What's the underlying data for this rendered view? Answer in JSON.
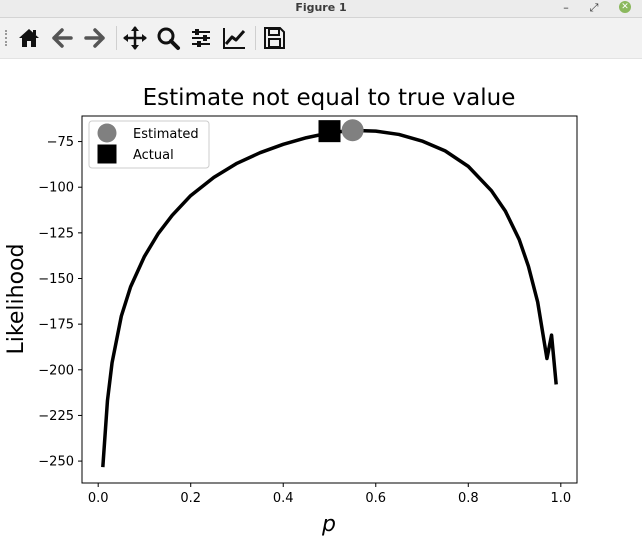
{
  "window": {
    "title": "Figure 1"
  },
  "toolbar": {
    "buttons": [
      "home-icon",
      "back-icon",
      "forward-icon",
      "pan-icon",
      "zoom-icon",
      "configure-subplots-icon",
      "edit-axis-icon",
      "save-icon"
    ]
  },
  "chart_data": {
    "type": "line",
    "title": "Estimate not equal to true value",
    "xlabel": "p",
    "ylabel": "Likelihood",
    "xlim": [
      -0.035,
      1.035
    ],
    "ylim": [
      -262,
      -61
    ],
    "xticks": [
      0.0,
      0.2,
      0.4,
      0.6,
      0.8,
      1.0
    ],
    "xtick_labels": [
      "0.0",
      "0.2",
      "0.4",
      "0.6",
      "0.8",
      "1.0"
    ],
    "yticks": [
      -75,
      -100,
      -125,
      -150,
      -175,
      -200,
      -225,
      -250
    ],
    "ytick_labels": [
      "−75",
      "−100",
      "−125",
      "−150",
      "−175",
      "−200",
      "−225",
      "−250"
    ],
    "grid": false,
    "series": [
      {
        "color": "#000000",
        "x": [
          0.01,
          0.02,
          0.03,
          0.05,
          0.07,
          0.1,
          0.13,
          0.16,
          0.2,
          0.25,
          0.3,
          0.35,
          0.4,
          0.45,
          0.5,
          0.55,
          0.6,
          0.65,
          0.7,
          0.75,
          0.8,
          0.85,
          0.88,
          0.91,
          0.93,
          0.95,
          0.97,
          0.98,
          0.99
        ],
        "y": [
          -253.3,
          -217.0,
          -196.1,
          -170.6,
          -154.6,
          -137.9,
          -125.3,
          -115.4,
          -104.6,
          -94.6,
          -86.9,
          -81.1,
          -76.5,
          -72.9,
          -70.2,
          -68.9,
          -69.3,
          -71.1,
          -74.7,
          -80.1,
          -88.6,
          -101.9,
          -113.0,
          -128.6,
          -143.3,
          -162.9,
          -193.8,
          -181.0,
          -208.0
        ]
      }
    ],
    "points": [
      {
        "name": "Estimated",
        "x": 0.55,
        "y": -68.8,
        "marker": "circle",
        "color": "#808080"
      },
      {
        "name": "Actual",
        "x": 0.5,
        "y": -69.3,
        "marker": "square",
        "color": "#000000"
      }
    ],
    "legend": {
      "placement": "upper left",
      "entries": [
        {
          "label": "Estimated",
          "marker": "circle",
          "color": "#808080"
        },
        {
          "label": "Actual",
          "marker": "square",
          "color": "#000000"
        }
      ]
    }
  }
}
